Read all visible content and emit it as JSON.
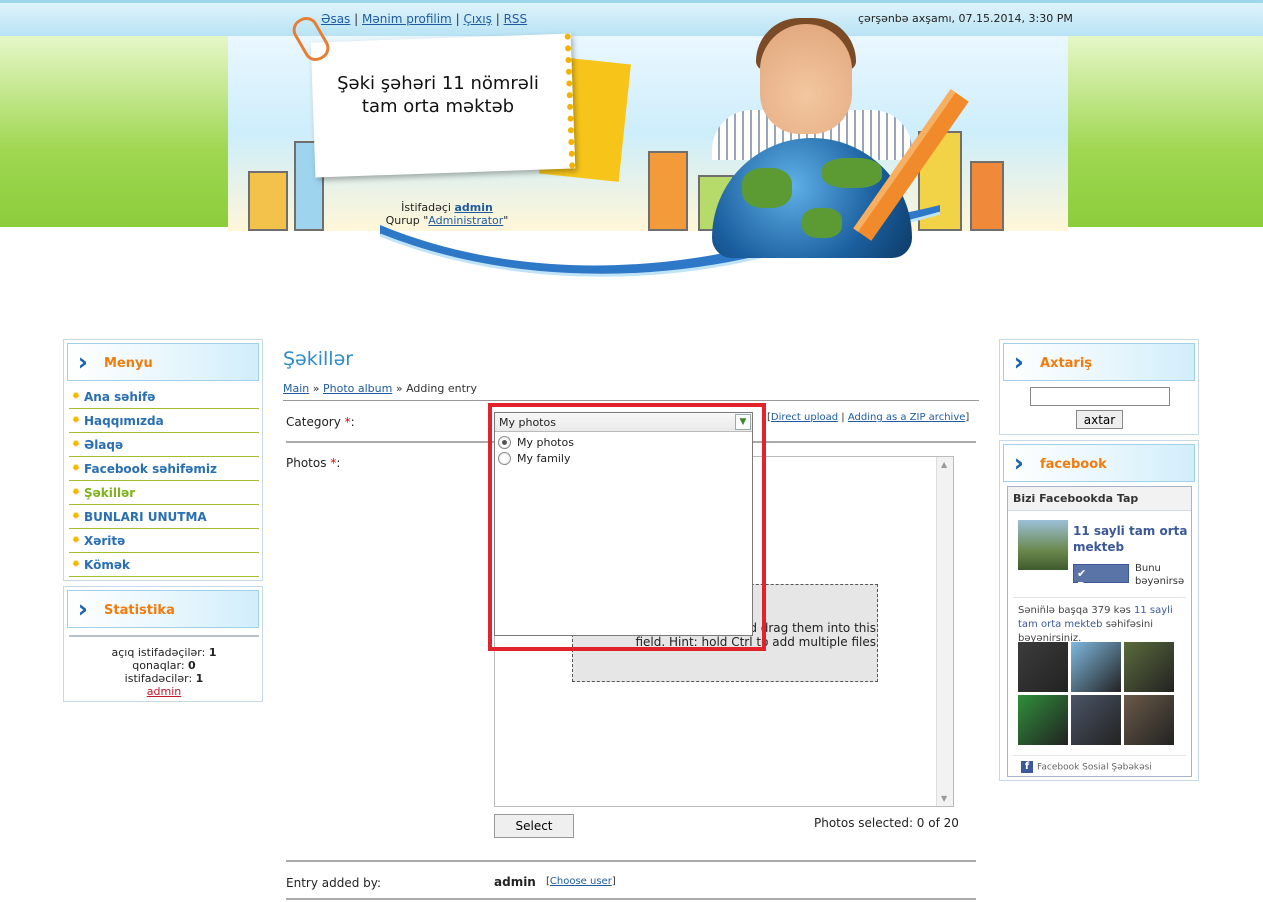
{
  "header": {
    "nav": [
      {
        "label": "Əsas"
      },
      {
        "label": "Mənim profilim"
      },
      {
        "label": "Çıxış"
      },
      {
        "label": "RSS"
      }
    ],
    "separator": "|",
    "datetime": "çərşənbə axşamı, 07.15.2014, 3:30 PM",
    "site_title_line1": "Şəki şəhəri 11 nömrəli",
    "site_title_line2": "tam orta məktəb",
    "user_prefix": "İstifadəçi",
    "user_name": "admin",
    "group_prefix": "Qurup \"",
    "group_name": "Administrator",
    "group_suffix": "\""
  },
  "menu": {
    "title": "Menyu",
    "items": [
      {
        "label": "Ana səhifə"
      },
      {
        "label": "Haqqımızda"
      },
      {
        "label": "Əlaqə"
      },
      {
        "label": "Facebook səhifəmiz"
      },
      {
        "label": "Şəkillər"
      },
      {
        "label": "BUNLARI UNUTMA"
      },
      {
        "label": "Xəritə"
      },
      {
        "label": "Kömək"
      }
    ],
    "active_index": 4,
    "bullet": "✹"
  },
  "stats": {
    "title": "Statistika",
    "rows": [
      {
        "label": "açıq istifadəçilər:",
        "value": "1"
      },
      {
        "label": "qonaqlar:",
        "value": "0"
      },
      {
        "label": "istifadəcilər:",
        "value": "1"
      }
    ],
    "user_link": "admin"
  },
  "search": {
    "title": "Axtariş",
    "button_label": "axtar",
    "input_value": ""
  },
  "facebook": {
    "title": "facebook",
    "box_title": "Bizi Facebookda Tap",
    "page_name": "11 sayli tam orta mekteb",
    "like_label": "Bəyən",
    "like_note": "Bunu bəyənirsə",
    "count_prefix": "Sənin̈lə başqa 379 kəs",
    "count_link": "11 sayli tam orta mekteb",
    "count_suffix": "səhifəsini bəyənirsiniz.",
    "footer": "Facebook Sosial Şəbəkəsi",
    "face_colors": [
      "#3c3c3c",
      "#7fb9e0",
      "#5b6b3c",
      "#2f8f3a",
      "#4a5566",
      "#6a5a48"
    ]
  },
  "main": {
    "title": "Şəkillər",
    "breadcrumb": {
      "main": "Main",
      "sep": "»",
      "album": "Photo album",
      "current": "Adding entry"
    },
    "category_label": "Category",
    "required_mark": "*",
    "colon": ":",
    "upload_links": {
      "open": "[",
      "direct": "Direct upload",
      "sep": "|",
      "zip": "Adding as a ZIP archive",
      "close": "]"
    },
    "photos_label": "Photos",
    "drop_text_line1": "nd drag them into this",
    "drop_text_line2": "field. Hint: hold Ctrl to add multiple files",
    "select_button": "Select",
    "photos_selected": "Photos selected: 0 of 20",
    "author_label": "Entry added by:",
    "author_value": "admin",
    "choose_user_open": "[",
    "choose_user": "Choose user",
    "choose_user_close": "]"
  },
  "dropdown": {
    "selected": "My photos",
    "options": [
      {
        "label": "My photos",
        "checked": true
      },
      {
        "label": "My family",
        "checked": false
      }
    ],
    "highlight_color": "#e1242b"
  }
}
